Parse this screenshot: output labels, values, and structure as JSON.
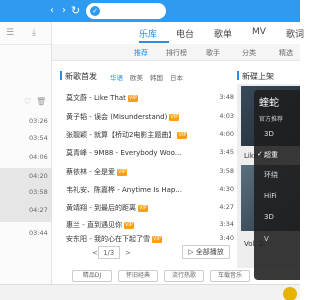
{
  "topbar": {
    "refresh_icon": "refresh-icon",
    "search_placeholder": ""
  },
  "main_tabs": [
    "乐库",
    "电台",
    "歌单",
    "MV",
    "歌词"
  ],
  "sub_tabs": [
    "推荐",
    "排行榜",
    "歌手",
    "分类",
    "精选"
  ],
  "section": {
    "title": "新歌首发",
    "filters": [
      "华语",
      "欧美",
      "韩国",
      "日本"
    ],
    "right_title": "新碟上架"
  },
  "songs": [
    {
      "title": "莫文蔚 - Like That",
      "vip": true,
      "duration": "3:48"
    },
    {
      "title": "黄子韬 - 误会 (Misunderstand)",
      "vip": true,
      "duration": "4:03"
    },
    {
      "title": "张靓颖 - 就算【桥动2电影主题曲】",
      "vip": true,
      "duration": "4:00"
    },
    {
      "title": "莫青峰 - 9M88 - Everybody Woo...",
      "vip": true,
      "duration": "3:45"
    },
    {
      "title": "蔡依林 - 全是爱",
      "vip": true,
      "duration": "3:58"
    },
    {
      "title": "韦礼安、陈嘉桦 - Anytime Is Hap...",
      "vip": true,
      "duration": "4:30"
    },
    {
      "title": "黄靖翔 - 到最后的距离",
      "vip": true,
      "duration": "4:27"
    },
    {
      "title": "惠兰 - 直到遇见你",
      "vip": true,
      "duration": "3:34"
    },
    {
      "title": "安东阳 - 我的心在下起了雪",
      "vip": true,
      "duration": "3:40"
    }
  ],
  "left_times": [
    "03:26",
    "03:54",
    "04:06",
    "04:20",
    "03:58",
    "04:27",
    "03:44"
  ],
  "pager": {
    "prev": "<",
    "page": "1/3",
    "next": ">",
    "play_all": "全部播放"
  },
  "bottom_tags": [
    "精品DJ",
    "怀旧经典",
    "流行热歌",
    "车载音乐"
  ],
  "thumbs": {
    "caption1": "Like That",
    "caption2": "Vol. 2"
  },
  "overlay": {
    "title": "蝰蛇",
    "subtitle": "官方推荐",
    "items": [
      {
        "label": "3D",
        "checked": false
      },
      {
        "label": "超重",
        "checked": true
      },
      {
        "label": "环绕",
        "checked": false
      },
      {
        "label": "HiFi",
        "checked": false
      },
      {
        "label": "3D",
        "checked": false
      },
      {
        "label": "V",
        "checked": false
      }
    ]
  },
  "colors": {
    "accent": "#2a8be8",
    "topbar": "#2f9bf0",
    "vip": "#ff9c1a"
  }
}
